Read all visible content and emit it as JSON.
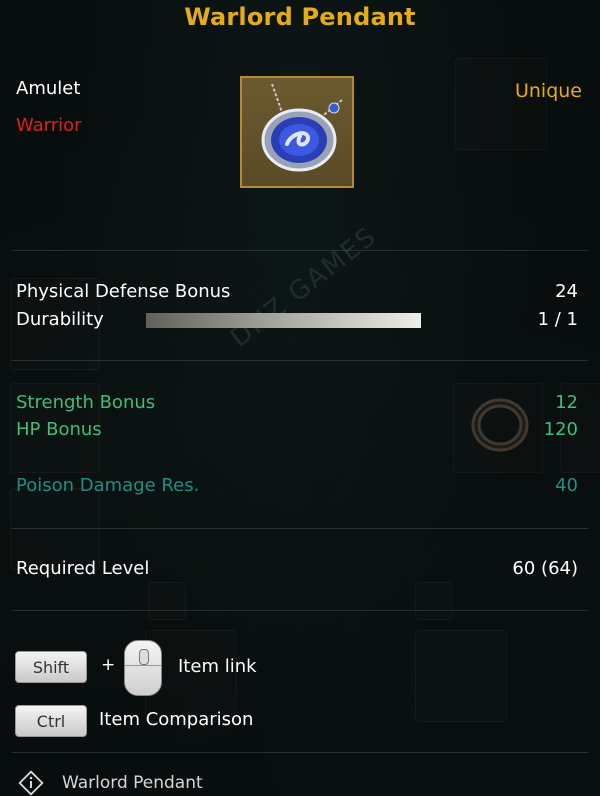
{
  "tooltip": {
    "title": "Warlord Pendant",
    "item_type": "Amulet",
    "class_restriction": "Warrior",
    "rarity": "Unique",
    "icon": "pendant-icon",
    "stats": {
      "physical_defense": {
        "label": "Physical Defense Bonus",
        "value": "24"
      },
      "durability": {
        "label": "Durability",
        "value": "1 / 1",
        "fraction": 1.0
      }
    },
    "bonuses": [
      {
        "label": "Strength Bonus",
        "value": "12"
      },
      {
        "label": "HP Bonus",
        "value": "120"
      }
    ],
    "resistance": {
      "label": "Poison Damage Res.",
      "value": "40"
    },
    "required_level": {
      "label": "Required Level",
      "value": "60 (64)"
    },
    "hints": {
      "shift_key": "Shift",
      "plus": "+",
      "item_link": "Item link",
      "ctrl_key": "Ctrl",
      "item_comparison": "Item Comparison"
    },
    "footer": {
      "icon": "info-icon",
      "label": "Warlord Pendant"
    }
  },
  "watermark": "DNZ GAMES",
  "colors": {
    "title": "#e4ad16",
    "class_restriction": "#e01f1f",
    "rarity": "#e4ad16",
    "bonus": "#3fbf75",
    "resistance": "#1f8f86"
  }
}
